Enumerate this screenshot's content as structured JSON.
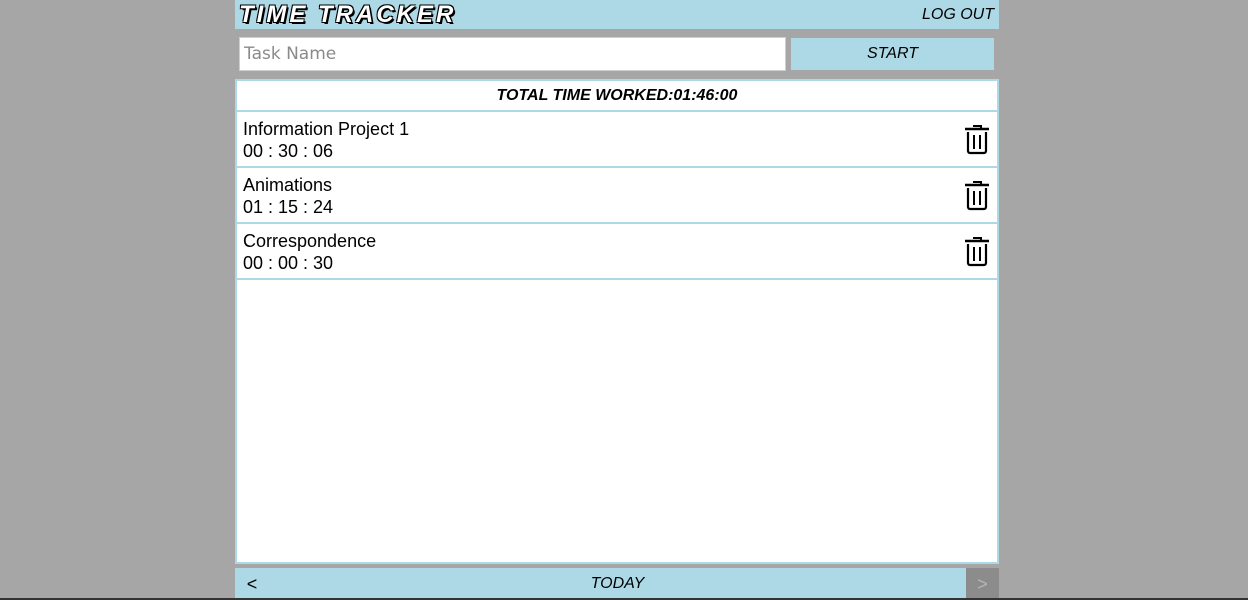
{
  "header": {
    "title": "TIME TRACKER",
    "logout_label": "LOG OUT"
  },
  "new_task": {
    "placeholder": "Task Name",
    "value": "",
    "start_label": "START"
  },
  "summary": {
    "total_label": "TOTAL TIME WORKED:01:46:00"
  },
  "tasks": [
    {
      "name": "Information Project 1",
      "time": "00 : 30 : 06",
      "delete_icon": "trash-icon"
    },
    {
      "name": "Animations",
      "time": "01 : 15 : 24",
      "delete_icon": "trash-icon"
    },
    {
      "name": "Correspondence",
      "time": "00 : 00 : 30",
      "delete_icon": "trash-icon"
    }
  ],
  "footer": {
    "prev_label": "<",
    "date_label": "TODAY",
    "next_label": ">",
    "next_enabled": false
  },
  "colors": {
    "background": "#a6a6a6",
    "accent": "#add8e6",
    "disabled": "#8c8c8c"
  }
}
